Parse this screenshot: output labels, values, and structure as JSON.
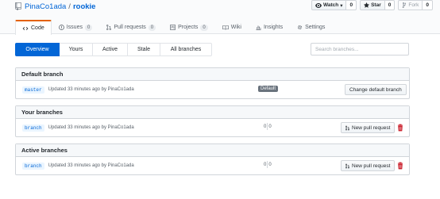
{
  "repo": {
    "owner": "PinaCo1ada",
    "separator": "/",
    "name": "rookie"
  },
  "actions": [
    {
      "label": "Watch",
      "caret": "▾",
      "count": "0",
      "icon": "eye-icon"
    },
    {
      "label": "Star",
      "count": "0",
      "icon": "star-icon"
    },
    {
      "label": "Fork",
      "count": "0",
      "icon": "fork-icon",
      "disabled": true
    }
  ],
  "tabs": [
    {
      "label": "Code",
      "icon": "code-icon",
      "selected": true
    },
    {
      "label": "Issues",
      "count": "0",
      "icon": "issue-icon"
    },
    {
      "label": "Pull requests",
      "count": "0",
      "icon": "pull-request-icon"
    },
    {
      "label": "Projects",
      "count": "0",
      "icon": "project-icon"
    },
    {
      "label": "Wiki",
      "icon": "book-icon"
    },
    {
      "label": "Insights",
      "icon": "graph-icon"
    },
    {
      "label": "Settings",
      "icon": "gear-icon"
    }
  ],
  "subnav": [
    {
      "label": "Overview",
      "selected": true
    },
    {
      "label": "Yours"
    },
    {
      "label": "Active"
    },
    {
      "label": "Stale"
    },
    {
      "label": "All branches"
    }
  ],
  "search": {
    "placeholder": "Search branches..."
  },
  "sections": {
    "default": {
      "title": "Default branch",
      "branch": "master",
      "meta": "Updated 33 minutes ago by PinaCo1ada",
      "badge": "Default",
      "button": "Change default branch"
    },
    "yours": {
      "title": "Your branches",
      "branch": "branch",
      "meta": "Updated 33 minutes ago by PinaCo1ada",
      "behind": "0",
      "ahead": "0",
      "button": "New pull request"
    },
    "active": {
      "title": "Active branches",
      "branch": "branch",
      "meta": "Updated 33 minutes ago by PinaCo1ada",
      "behind": "0",
      "ahead": "0",
      "button": "New pull request"
    }
  },
  "colors": {
    "link": "#0366d6",
    "tab_accent": "#e36209",
    "selected_subnav": "#0366d6",
    "delete": "#cb2431"
  }
}
